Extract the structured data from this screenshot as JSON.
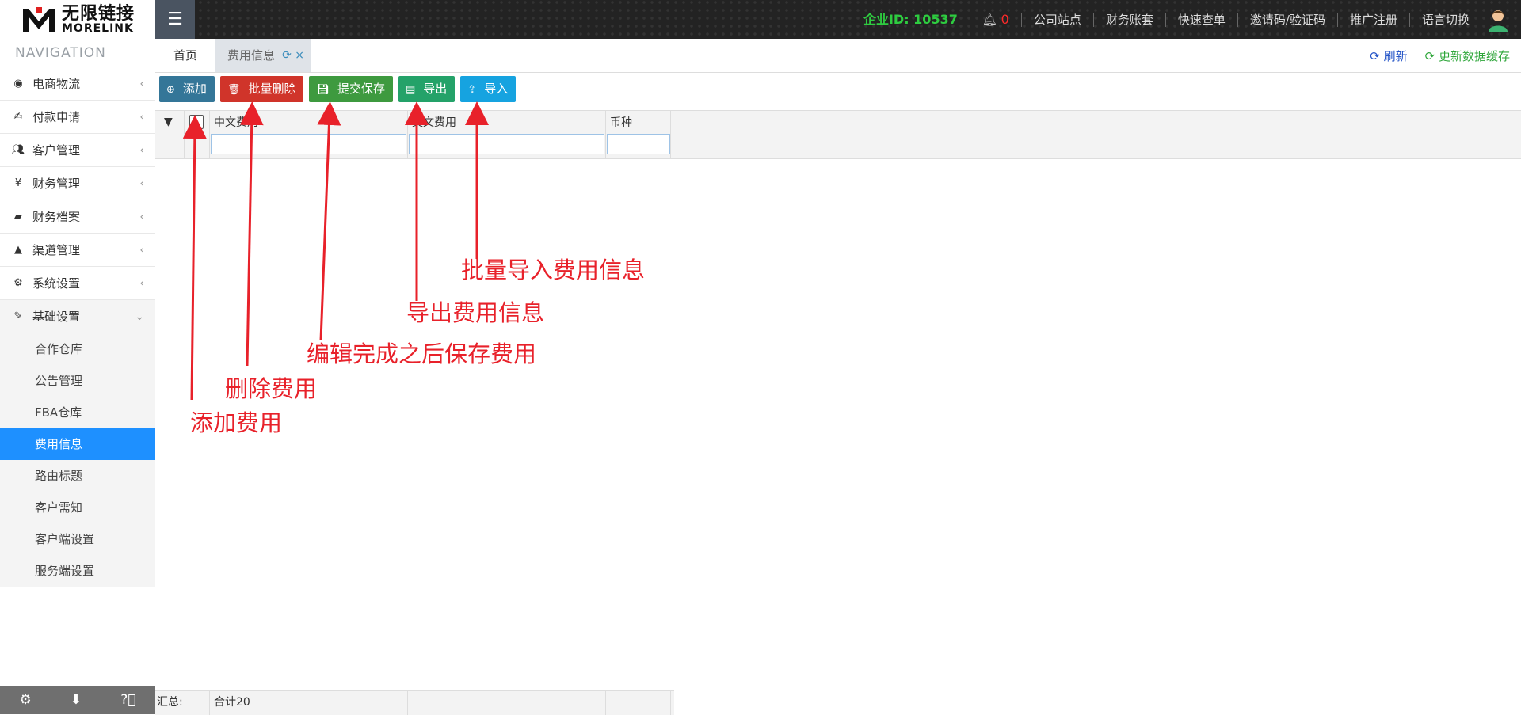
{
  "header": {
    "logo_cn": "无限链接",
    "logo_en": "MORELINK",
    "company_id": "企业ID:  10537",
    "notification_count": "0",
    "links": [
      "公司站点",
      "财务账套",
      "快速查单",
      "邀请码/验证码",
      "推广注册",
      "语言切换"
    ]
  },
  "sidebar": {
    "title": "NAVIGATION",
    "groups": [
      {
        "label": "电商物流",
        "icon": "globe-icon"
      },
      {
        "label": "付款申请",
        "icon": "payment-icon"
      },
      {
        "label": "客户管理",
        "icon": "users-icon"
      },
      {
        "label": "财务管理",
        "icon": "yen-icon"
      },
      {
        "label": "财务档案",
        "icon": "book-icon"
      },
      {
        "label": "渠道管理",
        "icon": "road-icon"
      },
      {
        "label": "系统设置",
        "icon": "gear-icon"
      },
      {
        "label": "基础设置",
        "icon": "edit-icon"
      }
    ],
    "sub_items": [
      "合作仓库",
      "公告管理",
      "FBA仓库",
      "费用信息",
      "路由标题",
      "客户需知",
      "客户端设置",
      "服务端设置"
    ],
    "active_sub_item": "费用信息"
  },
  "tabs": {
    "home": "首页",
    "current": "费用信息",
    "refresh": "刷新",
    "update_cache": "更新数据缓存"
  },
  "toolbar": {
    "add": "添加",
    "batch_delete": "批量删除",
    "submit_save": "提交保存",
    "export": "导出",
    "import": "导入"
  },
  "grid": {
    "columns": [
      "中文费用",
      "英文费用",
      "币种"
    ],
    "summary_label": "汇总:",
    "summary_total": "合计20"
  },
  "annotations": {
    "import": "批量导入费用信息",
    "export": "导出费用信息",
    "save": "编辑完成之后保存费用",
    "delete": "删除费用",
    "add": "添加费用"
  },
  "colors": {
    "annotation_red": "#e8212a",
    "active_nav": "#1e90ff",
    "company_id_green": "#2ecc40"
  }
}
